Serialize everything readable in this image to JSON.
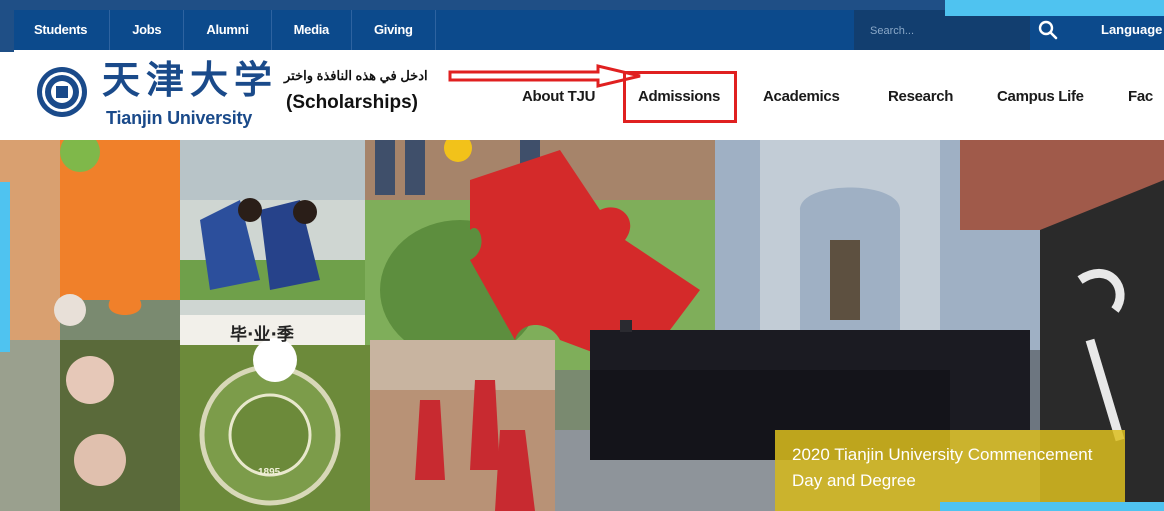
{
  "topbar": {
    "links": [
      "Students",
      "Jobs",
      "Alumni",
      "Media",
      "Giving"
    ],
    "search_placeholder": "Search...",
    "language": "Language"
  },
  "header": {
    "logo_cn": "天津大学",
    "logo_en": "Tianjin University",
    "annotation_arabic": "ادخل في هذه النافذة واختر",
    "annotation_english": "(Scholarships)",
    "nav": [
      "About TJU",
      "Admissions",
      "Academics",
      "Research",
      "Campus Life",
      "Fac"
    ]
  },
  "hero": {
    "banner_text": "毕·业·季",
    "seal_year": "1895",
    "caption": "2020 Tianjin University Commencement Day and Degree"
  },
  "colors": {
    "topbar_bg": "#0c4a8c",
    "brand_blue": "#1a4a8a",
    "highlight_red": "#e02020",
    "caption_gold": "#dcbe1e",
    "frame_accent": "#4fc3f0"
  },
  "icons": [
    "search-icon",
    "university-seal-icon",
    "arrow-icon"
  ]
}
